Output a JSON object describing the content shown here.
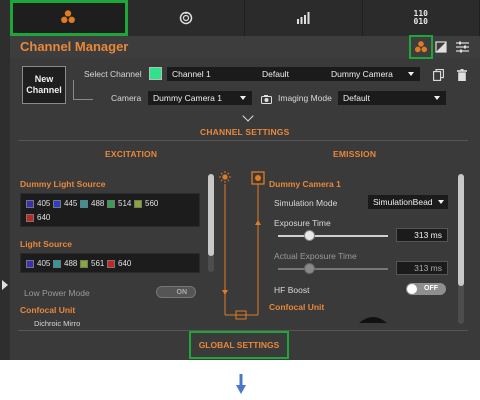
{
  "tabs": [
    {
      "icon": "channel-manager-icon",
      "active": true
    },
    {
      "icon": "timer-icon",
      "active": false
    },
    {
      "icon": "bar-chart-icon",
      "active": false
    },
    {
      "icon": "binary-icon",
      "label": "110\n010",
      "active": false
    }
  ],
  "header": {
    "title": "Channel Manager"
  },
  "channel": {
    "new_channel_label": "New\nChannel",
    "select_channel_label": "Select Channel",
    "selected_channel": "Channel 1",
    "preset": "Default",
    "camera_select": "Dummy Camera",
    "camera_label": "Camera",
    "camera_value": "Dummy Camera 1",
    "imaging_mode_label": "Imaging Mode",
    "imaging_mode_value": "Default",
    "swatch_color": "#2ee38a"
  },
  "sections": {
    "channel_settings": "CHANNEL SETTINGS",
    "excitation": "EXCITATION",
    "emission": "EMISSION",
    "global_settings": "GLOBAL SETTINGS"
  },
  "excitation": {
    "dummy_light_source": {
      "title": "Dummy Light Source",
      "wavelengths": [
        {
          "nm": "405",
          "color": "#3a2fb5"
        },
        {
          "nm": "445",
          "color": "#2f3cc8"
        },
        {
          "nm": "488",
          "color": "#2a9a9a"
        },
        {
          "nm": "514",
          "color": "#2fa34a"
        },
        {
          "nm": "560",
          "color": "#8aa82a"
        },
        {
          "nm": "640",
          "color": "#c42424"
        }
      ]
    },
    "light_source": {
      "title": "Light Source",
      "wavelengths": [
        {
          "nm": "405",
          "color": "#3a2fb5"
        },
        {
          "nm": "488",
          "color": "#2a9a9a"
        },
        {
          "nm": "561",
          "color": "#8aa82a"
        },
        {
          "nm": "640",
          "color": "#c42424"
        }
      ]
    },
    "low_power_mode_label": "Low Power Mode",
    "low_power_mode_toggle": "ON",
    "confocal_unit_title": "Confocal Unit",
    "dichroic_partial": "Dichroic Mirro"
  },
  "emission": {
    "camera_title": "Dummy Camera 1",
    "simulation_mode_label": "Simulation Mode",
    "simulation_mode_value": "SimulationBead",
    "exposure_time_label": "Exposure Time",
    "exposure_time_value": "313 ms",
    "exposure_time_fraction": 0.28,
    "actual_exposure_label": "Actual Exposure Time",
    "actual_exposure_value": "313 ms",
    "actual_exposure_fraction": 0.28,
    "hf_boost_label": "HF Boost",
    "hf_boost_value": "OFF",
    "confocal_unit_title": "Confocal Unit"
  },
  "colors": {
    "accent": "#e8883a",
    "highlight": "#1fa63a",
    "arrow": "#4a78c8"
  }
}
